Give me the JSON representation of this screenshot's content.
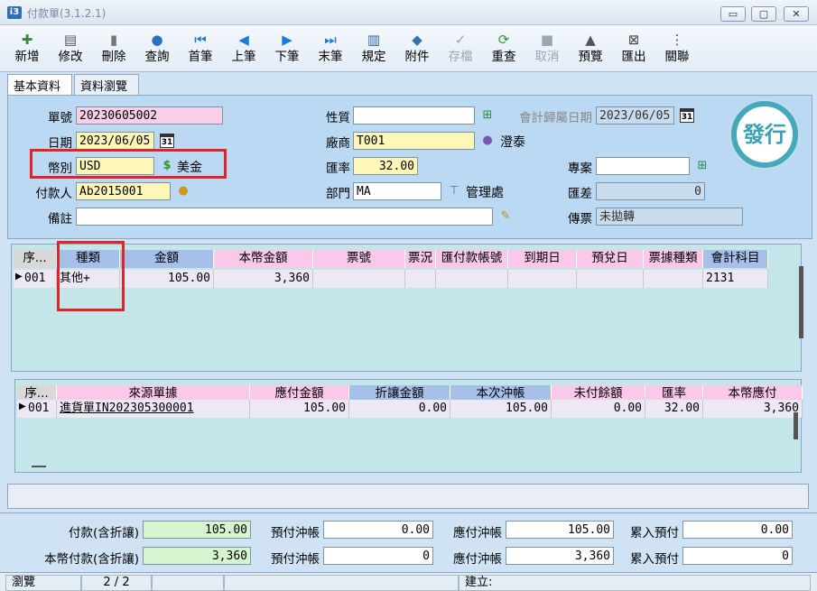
{
  "window": {
    "title": "付款單(3.1.2.1)",
    "app_icon": "i3",
    "min": "▭",
    "max": "▢",
    "close": "✕"
  },
  "toolbar": [
    {
      "label": "新增",
      "icon": "new-icon",
      "glyph": "✚",
      "color": "#3a8a3a",
      "enabled": true
    },
    {
      "label": "修改",
      "icon": "edit-icon",
      "glyph": "▤",
      "color": "#555",
      "enabled": true
    },
    {
      "label": "刪除",
      "icon": "delete-icon",
      "glyph": "▮",
      "color": "#777",
      "enabled": true
    },
    {
      "label": "查詢",
      "icon": "search-icon",
      "glyph": "●",
      "color": "#2b6fc4",
      "enabled": true
    },
    {
      "label": "首筆",
      "icon": "first-record-icon",
      "glyph": "⏮",
      "color": "#1c7ed6",
      "enabled": true
    },
    {
      "label": "上筆",
      "icon": "prev-record-icon",
      "glyph": "◀",
      "color": "#1c7ed6",
      "enabled": true
    },
    {
      "label": "下筆",
      "icon": "next-record-icon",
      "glyph": "▶",
      "color": "#1c7ed6",
      "enabled": true
    },
    {
      "label": "末筆",
      "icon": "last-record-icon",
      "glyph": "⏭",
      "color": "#1c7ed6",
      "enabled": true
    },
    {
      "label": "規定",
      "icon": "book-icon",
      "glyph": "▥",
      "color": "#2b5fa4",
      "enabled": true
    },
    {
      "label": "附件",
      "icon": "attachment-icon",
      "glyph": "◆",
      "color": "#3a6ea5",
      "enabled": true
    },
    {
      "label": "存檔",
      "icon": "save-icon",
      "glyph": "✓",
      "color": "#9aa6b2",
      "enabled": false
    },
    {
      "label": "重查",
      "icon": "refresh-icon",
      "glyph": "⟳",
      "color": "#2f9a3a",
      "enabled": true
    },
    {
      "label": "取消",
      "icon": "cancel-icon",
      "glyph": "■",
      "color": "#9aa6b2",
      "enabled": false
    },
    {
      "label": "預覽",
      "icon": "preview-icon",
      "glyph": "▲",
      "color": "#555",
      "enabled": true
    },
    {
      "label": "匯出",
      "icon": "export-icon",
      "glyph": "⊠",
      "color": "#444",
      "enabled": true
    },
    {
      "label": "關聯",
      "icon": "link-icon",
      "glyph": "⋮",
      "color": "#444",
      "enabled": true
    }
  ],
  "tabs": [
    "基本資料",
    "資料瀏覽"
  ],
  "form": {
    "doc_no_label": "單號",
    "doc_no": "20230605002",
    "date_label": "日期",
    "date": "2023/06/05",
    "cal_glyph": "31",
    "currency_label": "幣別",
    "currency": "USD",
    "currency_name": "美金",
    "payer_label": "付款人",
    "payer": "Ab2015001",
    "remark_label": "備註",
    "remark": "",
    "nature_label": "性質",
    "nature": "",
    "vendor_label": "廠商",
    "vendor": "T001",
    "vendor_name": "澄泰",
    "rate_label": "匯率",
    "rate": "32.00",
    "dept_label": "部門",
    "dept": "MA",
    "dept_name": "管理處",
    "acct_date_label": "會計歸屬日期",
    "acct_date": "2023/06/05",
    "project_label": "專案",
    "project": "",
    "rate_diff_label": "匯差",
    "rate_diff": "0",
    "voucher_label": "傳票",
    "voucher": "未拋轉",
    "stamp": "發行"
  },
  "grid1": {
    "headers": [
      "序...",
      "種類",
      "金額",
      "本幣金額",
      "票號",
      "票況",
      "匯付款帳號",
      "到期日",
      "預兌日",
      "票據種類",
      "會計科目"
    ],
    "rows": [
      [
        "001",
        "其他+",
        "105.00",
        "3,360",
        "",
        "",
        "",
        "",
        "",
        "",
        "2131"
      ]
    ]
  },
  "grid2": {
    "headers": [
      "序...",
      "來源單據",
      "應付金額",
      "折讓金額",
      "本次沖帳",
      "未付餘額",
      "匯率",
      "本幣應付"
    ],
    "rows": [
      [
        "001",
        "進貨單IN202305300001",
        "105.00",
        "0.00",
        "105.00",
        "0.00",
        "32.00",
        "3,360"
      ]
    ]
  },
  "footer": {
    "pay_label": "付款(含折讓)",
    "pay": "105.00",
    "base_pay_label": "本幣付款(含折讓)",
    "base_pay": "3,360",
    "prepay1_label": "預付沖帳",
    "prepay1": "0.00",
    "prepay2_label": "預付沖帳",
    "prepay2": "0",
    "payable1_label": "應付沖帳",
    "payable1": "105.00",
    "payable2_label": "應付沖帳",
    "payable2": "3,360",
    "accum1_label": "累入預付",
    "accum1": "0.00",
    "accum2_label": "累入預付",
    "accum2": "0"
  },
  "status": {
    "mode": "瀏覽",
    "record": "2 / 2",
    "created": "建立:"
  }
}
